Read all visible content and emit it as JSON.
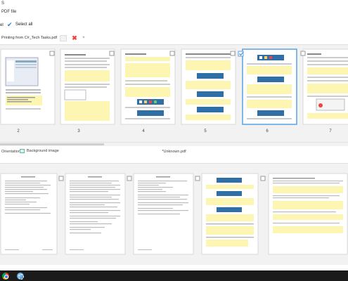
{
  "header": {
    "app_letter": "S",
    "section_title": "PDF file"
  },
  "selection": {
    "left_fragment": "el",
    "select_all": "Select all"
  },
  "file_tab": {
    "name": "Printing from C#_Tech Tasks.pdf",
    "remove_icon": "red-x-icon",
    "close": "×"
  },
  "top_strip": {
    "pages": [
      {
        "number": "2",
        "selected": false
      },
      {
        "number": "3",
        "selected": false
      },
      {
        "number": "4",
        "selected": false
      },
      {
        "number": "5",
        "selected": false
      },
      {
        "number": "6",
        "selected": true
      },
      {
        "number": "7",
        "selected": false
      }
    ]
  },
  "output_toolbar": {
    "orientation": "Orientation",
    "background_image": "Background image",
    "file_name": "*Unknown.pdf"
  },
  "taskbar": {
    "icons": [
      "chrome-icon",
      "app-icon"
    ]
  },
  "colors": {
    "accent": "#2d7bd8",
    "selected_border": "#5aa0e0",
    "highlight": "#fdf6b2",
    "taskbar": "#1b1b1b"
  }
}
